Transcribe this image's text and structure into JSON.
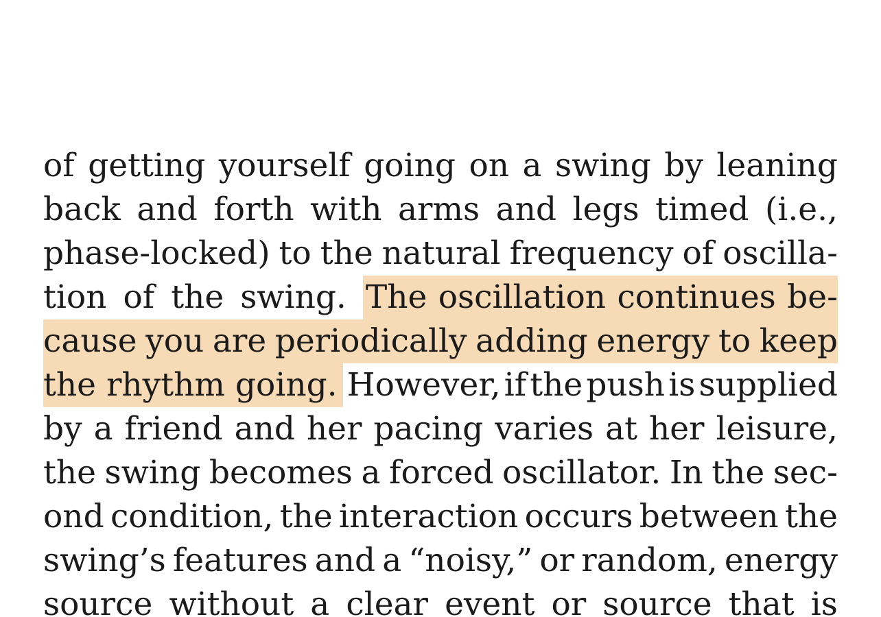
{
  "page": {
    "background": "#ffffff",
    "text_color": "#1b1b1b",
    "highlight_color": "#f7dab6"
  },
  "lines": [
    [
      "of",
      "getting",
      "yourself",
      "going",
      "on",
      "a",
      "swing",
      "by",
      "leaning"
    ],
    [
      "back",
      "and",
      "forth",
      "with",
      "arms",
      "and",
      "legs",
      "timed",
      "(i.e.,"
    ],
    [
      "phase-locked)",
      "to",
      "the",
      "natural",
      "frequency",
      "of",
      "oscilla-"
    ],
    [
      "tion",
      "of",
      "the",
      "swing."
    ],
    [
      "cause",
      "you",
      "are",
      "periodically",
      "adding",
      "energy",
      "to",
      "keep"
    ],
    [
      "However,",
      "if",
      "the",
      "push",
      "is",
      "supplied"
    ],
    [
      "by",
      "a",
      "friend",
      "and",
      "her",
      "pacing",
      "varies",
      "at",
      "her",
      "leisure,"
    ],
    [
      "the",
      "swing",
      "becomes",
      "a",
      "forced",
      "oscillator.",
      "In",
      "the",
      "sec-"
    ],
    [
      "ond",
      "condition,",
      "the",
      "interaction",
      "occurs",
      "between",
      "the"
    ],
    [
      "swing’s",
      "features",
      "and",
      "a",
      "“noisy,”",
      "or",
      "random,",
      "energy"
    ],
    [
      "source",
      "without",
      "a",
      "clear",
      "event",
      "or",
      "source",
      "that",
      "is"
    ]
  ],
  "highlight": {
    "line4_words": [
      "The",
      "oscillation",
      "continues",
      "be-"
    ],
    "line6_words": [
      "the",
      "rhythm",
      "going."
    ]
  }
}
